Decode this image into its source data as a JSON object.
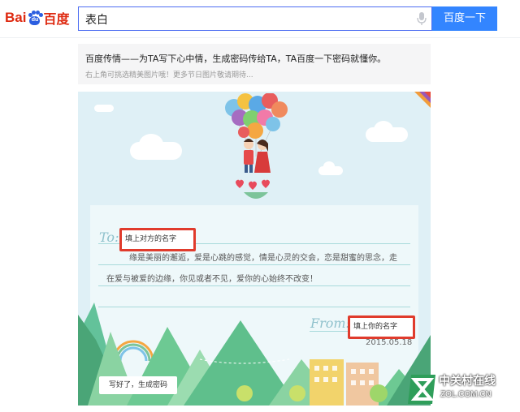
{
  "header": {
    "logo_text_left": "Bai",
    "logo_text_paw": "du",
    "logo_text_right": "百度",
    "search_value": "表白",
    "search_button": "百度一下"
  },
  "info": {
    "title": "百度传情——为TA写下心中情，生成密码传给TA，TA百度一下密码就懂你。",
    "subtitle": "右上角可挑选精美图片哦！更多节日图片敬请期待..."
  },
  "card": {
    "to_label": "To:",
    "to_input_value": "填上对方的名字",
    "message_line1": "缘是美丽的邂逅，爱是心跳的感觉，情是心灵的交会，恋是甜蜜的思念，走",
    "message_line2": "在爱与被爱的边缘，你见或者不见，爱你的心始终不改变！",
    "from_label": "From:",
    "from_input_value": "填上你的名字",
    "date": "2015.05.18",
    "generate_button": "写好了，生成密码"
  },
  "watermark": {
    "title": "中关村在线",
    "subtitle": "ZOL.COM.CN"
  },
  "colors": {
    "brand_red": "#de2910",
    "brand_blue": "#2b5ee0",
    "button_blue": "#3385ff",
    "highlight_red": "#e03b2c",
    "card_sky": "#dff0f6"
  },
  "icons": [
    "baidu-paw-icon",
    "microphone-icon",
    "corner-ribbon-icon",
    "balloon-couple-illustration",
    "zol-logo-icon"
  ]
}
